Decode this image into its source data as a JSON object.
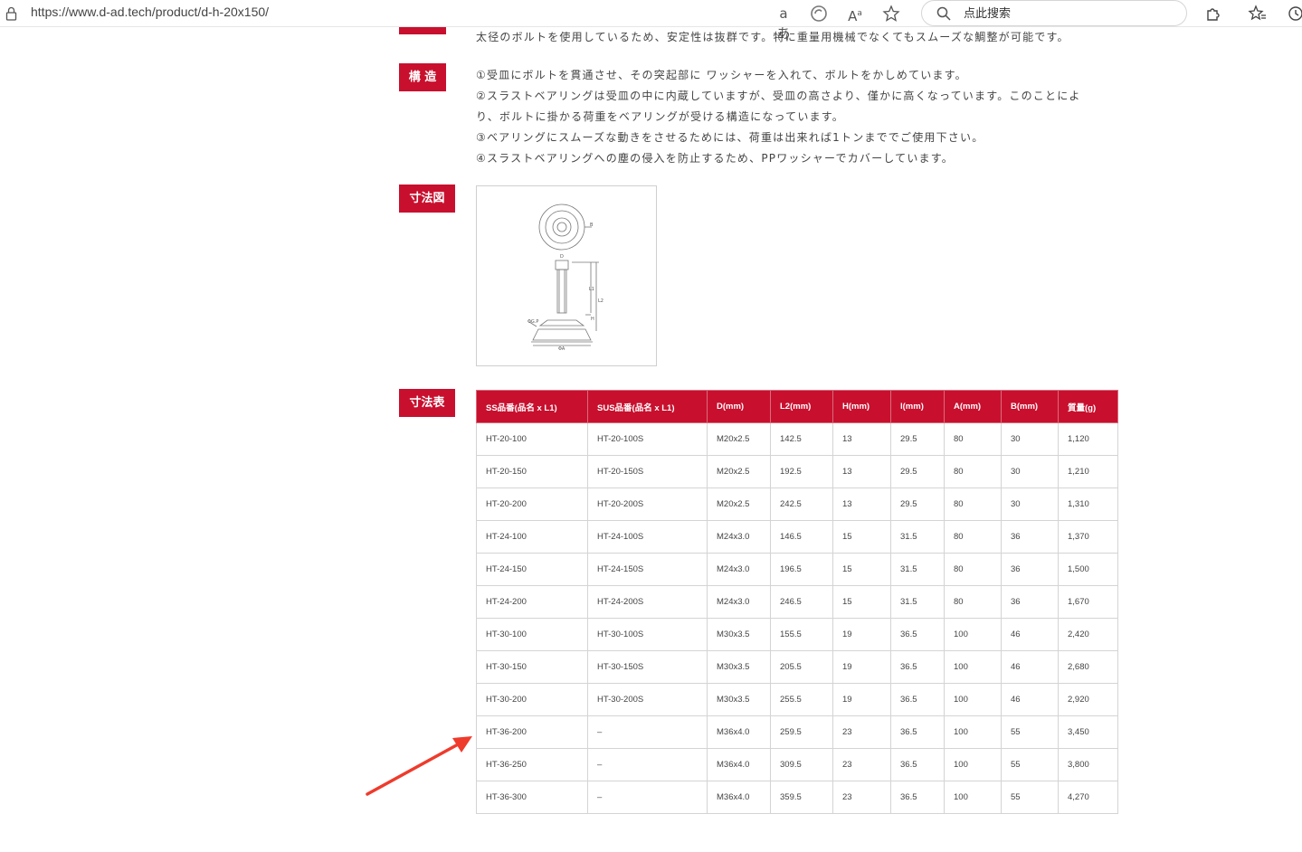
{
  "browser": {
    "url": "https://www.d-ad.tech/product/d-h-20x150/",
    "search_placeholder": "点此搜索",
    "icons": [
      "lock-icon",
      "read-aloud-aa-icon",
      "refresh-icon",
      "text-size-icon",
      "favorite-star-icon",
      "search-icon",
      "extensions-icon",
      "favorites-icon",
      "history-icon"
    ]
  },
  "sections": {
    "intro_line": "太径のボルトを使用しているため、安定性は抜群です。特に重量用機械でなくてもスムーズな鯛整が可能です。",
    "structure": {
      "label": "構 造",
      "lines": [
        "①受皿にボルトを貫通させ、その突起部に ワッシャーを入れて、ボルトをかしめています。",
        "②スラストベアリングは受皿の中に内蔵していますが、受皿の高さより、僅かに高くなっています。このことによ",
        "り、ボルトに掛かる荷重をベアリングが受ける構造になっています。",
        "③ベアリングにスムーズな動きをさせるためには、荷重は出来れば1トンまででご使用下さい。",
        "④スラストベアリングへの塵の侵入を防止するため、PPワッシャーでカバーしています。"
      ]
    },
    "drawing": {
      "label": "寸法図",
      "labels": {
        "b": "B",
        "d": "D",
        "l1": "L1",
        "l2": "L2",
        "h": "H",
        "left": "ΦG.P",
        "bottom": "ΦA"
      }
    },
    "table": {
      "label": "寸法表",
      "headers": [
        "SS品番(品名 x L1)",
        "SUS品番(品名 x L1)",
        "D(mm)",
        "L2(mm)",
        "H(mm)",
        "l(mm)",
        "A(mm)",
        "B(mm)",
        "質量(g)"
      ],
      "rows": [
        [
          "HT-20-100",
          "HT-20-100S",
          "M20x2.5",
          "142.5",
          "13",
          "29.5",
          "80",
          "30",
          "1,120"
        ],
        [
          "HT-20-150",
          "HT-20-150S",
          "M20x2.5",
          "192.5",
          "13",
          "29.5",
          "80",
          "30",
          "1,210"
        ],
        [
          "HT-20-200",
          "HT-20-200S",
          "M20x2.5",
          "242.5",
          "13",
          "29.5",
          "80",
          "30",
          "1,310"
        ],
        [
          "HT-24-100",
          "HT-24-100S",
          "M24x3.0",
          "146.5",
          "15",
          "31.5",
          "80",
          "36",
          "1,370"
        ],
        [
          "HT-24-150",
          "HT-24-150S",
          "M24x3.0",
          "196.5",
          "15",
          "31.5",
          "80",
          "36",
          "1,500"
        ],
        [
          "HT-24-200",
          "HT-24-200S",
          "M24x3.0",
          "246.5",
          "15",
          "31.5",
          "80",
          "36",
          "1,670"
        ],
        [
          "HT-30-100",
          "HT-30-100S",
          "M30x3.5",
          "155.5",
          "19",
          "36.5",
          "100",
          "46",
          "2,420"
        ],
        [
          "HT-30-150",
          "HT-30-150S",
          "M30x3.5",
          "205.5",
          "19",
          "36.5",
          "100",
          "46",
          "2,680"
        ],
        [
          "HT-30-200",
          "HT-30-200S",
          "M30x3.5",
          "255.5",
          "19",
          "36.5",
          "100",
          "46",
          "2,920"
        ],
        [
          "HT-36-200",
          "–",
          "M36x4.0",
          "259.5",
          "23",
          "36.5",
          "100",
          "55",
          "3,450"
        ],
        [
          "HT-36-250",
          "–",
          "M36x4.0",
          "309.5",
          "23",
          "36.5",
          "100",
          "55",
          "3,800"
        ],
        [
          "HT-36-300",
          "–",
          "M36x4.0",
          "359.5",
          "23",
          "36.5",
          "100",
          "55",
          "4,270"
        ]
      ]
    }
  },
  "colors": {
    "accent": "#c8102e",
    "arrow": "#ee3b2c"
  }
}
